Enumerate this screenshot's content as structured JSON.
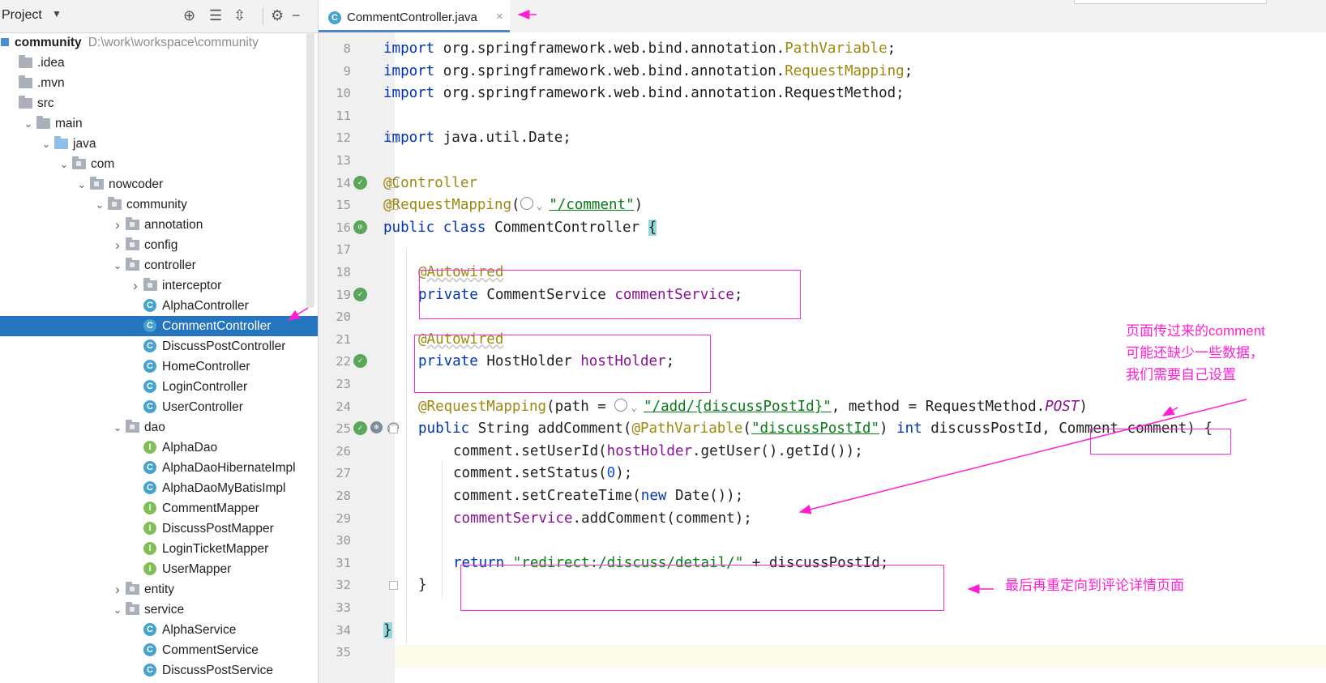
{
  "sidebar": {
    "title": "Project",
    "tree": [
      {
        "label": "community",
        "path": "D:\\work\\workspace\\community",
        "kind": "module",
        "level": 0,
        "chevron": ""
      },
      {
        "label": ".idea",
        "kind": "folder",
        "level": 1,
        "chevron": ""
      },
      {
        "label": ".mvn",
        "kind": "folder",
        "level": 1,
        "chevron": ""
      },
      {
        "label": "src",
        "kind": "folder",
        "level": 1,
        "chevron": ""
      },
      {
        "label": "main",
        "kind": "folder",
        "level": 2,
        "chevron": "open"
      },
      {
        "label": "java",
        "kind": "src",
        "level": 3,
        "chevron": "open"
      },
      {
        "label": "com",
        "kind": "pkg",
        "level": 4,
        "chevron": "open"
      },
      {
        "label": "nowcoder",
        "kind": "pkg",
        "level": 5,
        "chevron": "open"
      },
      {
        "label": "community",
        "kind": "pkg",
        "level": 6,
        "chevron": "open"
      },
      {
        "label": "annotation",
        "kind": "pkg",
        "level": 7,
        "chevron": "closed"
      },
      {
        "label": "config",
        "kind": "pkg",
        "level": 7,
        "chevron": "closed"
      },
      {
        "label": "controller",
        "kind": "pkg",
        "level": 7,
        "chevron": "open"
      },
      {
        "label": "interceptor",
        "kind": "pkg",
        "level": 8,
        "chevron": "closed"
      },
      {
        "label": "AlphaController",
        "kind": "class",
        "level": 8,
        "chevron": ""
      },
      {
        "label": "CommentController",
        "kind": "class",
        "level": 8,
        "chevron": "",
        "selected": true
      },
      {
        "label": "DiscussPostController",
        "kind": "class",
        "level": 8,
        "chevron": ""
      },
      {
        "label": "HomeController",
        "kind": "class",
        "level": 8,
        "chevron": ""
      },
      {
        "label": "LoginController",
        "kind": "class",
        "level": 8,
        "chevron": ""
      },
      {
        "label": "UserController",
        "kind": "class",
        "level": 8,
        "chevron": ""
      },
      {
        "label": "dao",
        "kind": "pkg",
        "level": 7,
        "chevron": "open"
      },
      {
        "label": "AlphaDao",
        "kind": "interface",
        "level": 8,
        "chevron": ""
      },
      {
        "label": "AlphaDaoHibernateImpl",
        "kind": "class",
        "level": 8,
        "chevron": ""
      },
      {
        "label": "AlphaDaoMyBatisImpl",
        "kind": "class",
        "level": 8,
        "chevron": ""
      },
      {
        "label": "CommentMapper",
        "kind": "interface",
        "level": 8,
        "chevron": ""
      },
      {
        "label": "DiscussPostMapper",
        "kind": "interface",
        "level": 8,
        "chevron": ""
      },
      {
        "label": "LoginTicketMapper",
        "kind": "interface",
        "level": 8,
        "chevron": ""
      },
      {
        "label": "UserMapper",
        "kind": "interface",
        "level": 8,
        "chevron": ""
      },
      {
        "label": "entity",
        "kind": "pkg",
        "level": 7,
        "chevron": "closed"
      },
      {
        "label": "service",
        "kind": "pkg",
        "level": 7,
        "chevron": "open"
      },
      {
        "label": "AlphaService",
        "kind": "class",
        "level": 8,
        "chevron": ""
      },
      {
        "label": "CommentService",
        "kind": "class",
        "level": 8,
        "chevron": ""
      },
      {
        "label": "DiscussPostService",
        "kind": "class",
        "level": 8,
        "chevron": ""
      }
    ]
  },
  "editor": {
    "tab_title": "CommentController.java",
    "tab_close": "×",
    "lines": [
      {
        "n": "8",
        "indent": 0,
        "tokens": [
          [
            "kw",
            "import"
          ],
          [
            "",
            "org.springframework.web.bind.annotation."
          ],
          [
            "ann",
            "PathVariable"
          ],
          [
            "",
            ";"
          ]
        ]
      },
      {
        "n": "9",
        "indent": 0,
        "tokens": [
          [
            "kw",
            "import"
          ],
          [
            "",
            "org.springframework.web.bind.annotation."
          ],
          [
            "ann",
            "RequestMapping"
          ],
          [
            "",
            ";"
          ]
        ]
      },
      {
        "n": "10",
        "indent": 0,
        "tokens": [
          [
            "kw",
            "import"
          ],
          [
            "",
            "org.springframework.web.bind.annotation.RequestMethod;"
          ]
        ]
      },
      {
        "n": "11",
        "indent": 0,
        "tokens": []
      },
      {
        "n": "12",
        "indent": 0,
        "fold": true,
        "tokens": [
          [
            "kw",
            "import"
          ],
          [
            "",
            "java.util.Date;"
          ]
        ]
      },
      {
        "n": "13",
        "indent": 0,
        "tokens": []
      },
      {
        "n": "14",
        "indent": 0,
        "gutter": "bean",
        "fold": true,
        "tokens": [
          [
            "ann",
            "@Controller"
          ]
        ]
      },
      {
        "n": "15",
        "indent": 0,
        "fold": true,
        "tokens": [
          [
            "ann",
            "@RequestMapping"
          ],
          [
            "",
            "("
          ],
          [
            "globe",
            ""
          ],
          [
            "strlink",
            "\"/comment\""
          ],
          [
            "",
            ")"
          ]
        ]
      },
      {
        "n": "16",
        "indent": 0,
        "gutter": "bean2",
        "tokens": [
          [
            "kw",
            "public class"
          ],
          [
            "",
            "CommentController "
          ],
          [
            "brace",
            "{"
          ]
        ]
      },
      {
        "n": "17",
        "indent": 1,
        "tokens": []
      },
      {
        "n": "18",
        "indent": 1,
        "tokens": [
          [
            "annsq",
            "@Autowired"
          ]
        ]
      },
      {
        "n": "19",
        "indent": 1,
        "gutter": "bean",
        "tokens": [
          [
            "kw",
            "private"
          ],
          [
            "",
            "CommentService "
          ],
          [
            "field",
            "commentService"
          ],
          [
            "",
            ";"
          ]
        ]
      },
      {
        "n": "20",
        "indent": 1,
        "tokens": []
      },
      {
        "n": "21",
        "indent": 1,
        "tokens": [
          [
            "annsq",
            "@Autowired"
          ]
        ]
      },
      {
        "n": "22",
        "indent": 1,
        "gutter": "bean",
        "tokens": [
          [
            "kw",
            "private"
          ],
          [
            "",
            "HostHolder "
          ],
          [
            "field",
            "hostHolder"
          ],
          [
            "",
            ";"
          ]
        ]
      },
      {
        "n": "23",
        "indent": 1,
        "tokens": []
      },
      {
        "n": "24",
        "indent": 1,
        "tokens": [
          [
            "ann",
            "@RequestMapping"
          ],
          [
            "",
            "(path = "
          ],
          [
            "globe",
            ""
          ],
          [
            "strlink",
            "\"/add/{discussPostId}\""
          ],
          [
            "",
            ", method = RequestMethod."
          ],
          [
            "fielditalic",
            "POST"
          ],
          [
            "",
            ")"
          ]
        ]
      },
      {
        "n": "25",
        "indent": 1,
        "gutter": "bean3",
        "fold": true,
        "tokens": [
          [
            "kw",
            "public"
          ],
          [
            "",
            "String "
          ],
          [
            "",
            "addComment("
          ],
          [
            "ann",
            "@PathVariable"
          ],
          [
            "",
            "("
          ],
          [
            "strlink",
            "\"discussPostId\""
          ],
          [
            "",
            ") "
          ],
          [
            "kw",
            "int"
          ],
          [
            "",
            "discussPostId, Comment comment) {"
          ]
        ]
      },
      {
        "n": "26",
        "indent": 2,
        "tokens": [
          [
            "",
            "comment.setUserId("
          ],
          [
            "field",
            "hostHolder"
          ],
          [
            "",
            ".getUser().getId());"
          ]
        ]
      },
      {
        "n": "27",
        "indent": 2,
        "tokens": [
          [
            "",
            "comment.setStatus("
          ],
          [
            "num",
            "0"
          ],
          [
            "",
            ");"
          ]
        ]
      },
      {
        "n": "28",
        "indent": 2,
        "tokens": [
          [
            "",
            "comment.setCreateTime("
          ],
          [
            "kw",
            "new"
          ],
          [
            "",
            "Date());"
          ]
        ]
      },
      {
        "n": "29",
        "indent": 2,
        "tokens": [
          [
            "field",
            "commentService"
          ],
          [
            "",
            ".addComment(comment);"
          ]
        ]
      },
      {
        "n": "30",
        "indent": 2,
        "tokens": []
      },
      {
        "n": "31",
        "indent": 2,
        "tokens": [
          [
            "kw",
            "return"
          ],
          [
            "str",
            "\"redirect:/discuss/detail/\""
          ],
          [
            "",
            " + discussPostId;"
          ]
        ]
      },
      {
        "n": "32",
        "indent": 1,
        "fold": true,
        "tokens": [
          [
            "",
            "}"
          ]
        ]
      },
      {
        "n": "33",
        "indent": 0,
        "tokens": []
      },
      {
        "n": "34",
        "indent": 0,
        "tokens": [
          [
            "brace",
            "}"
          ]
        ]
      },
      {
        "n": "35",
        "indent": 0,
        "tokens": []
      }
    ]
  },
  "annotations": {
    "note_comment": [
      "页面传过来的comment",
      "可能还缺少一些数据，",
      "我们需要自己设置"
    ],
    "note_redirect": "最后再重定向到评论详情页面",
    "color": "#ff1fd3"
  }
}
